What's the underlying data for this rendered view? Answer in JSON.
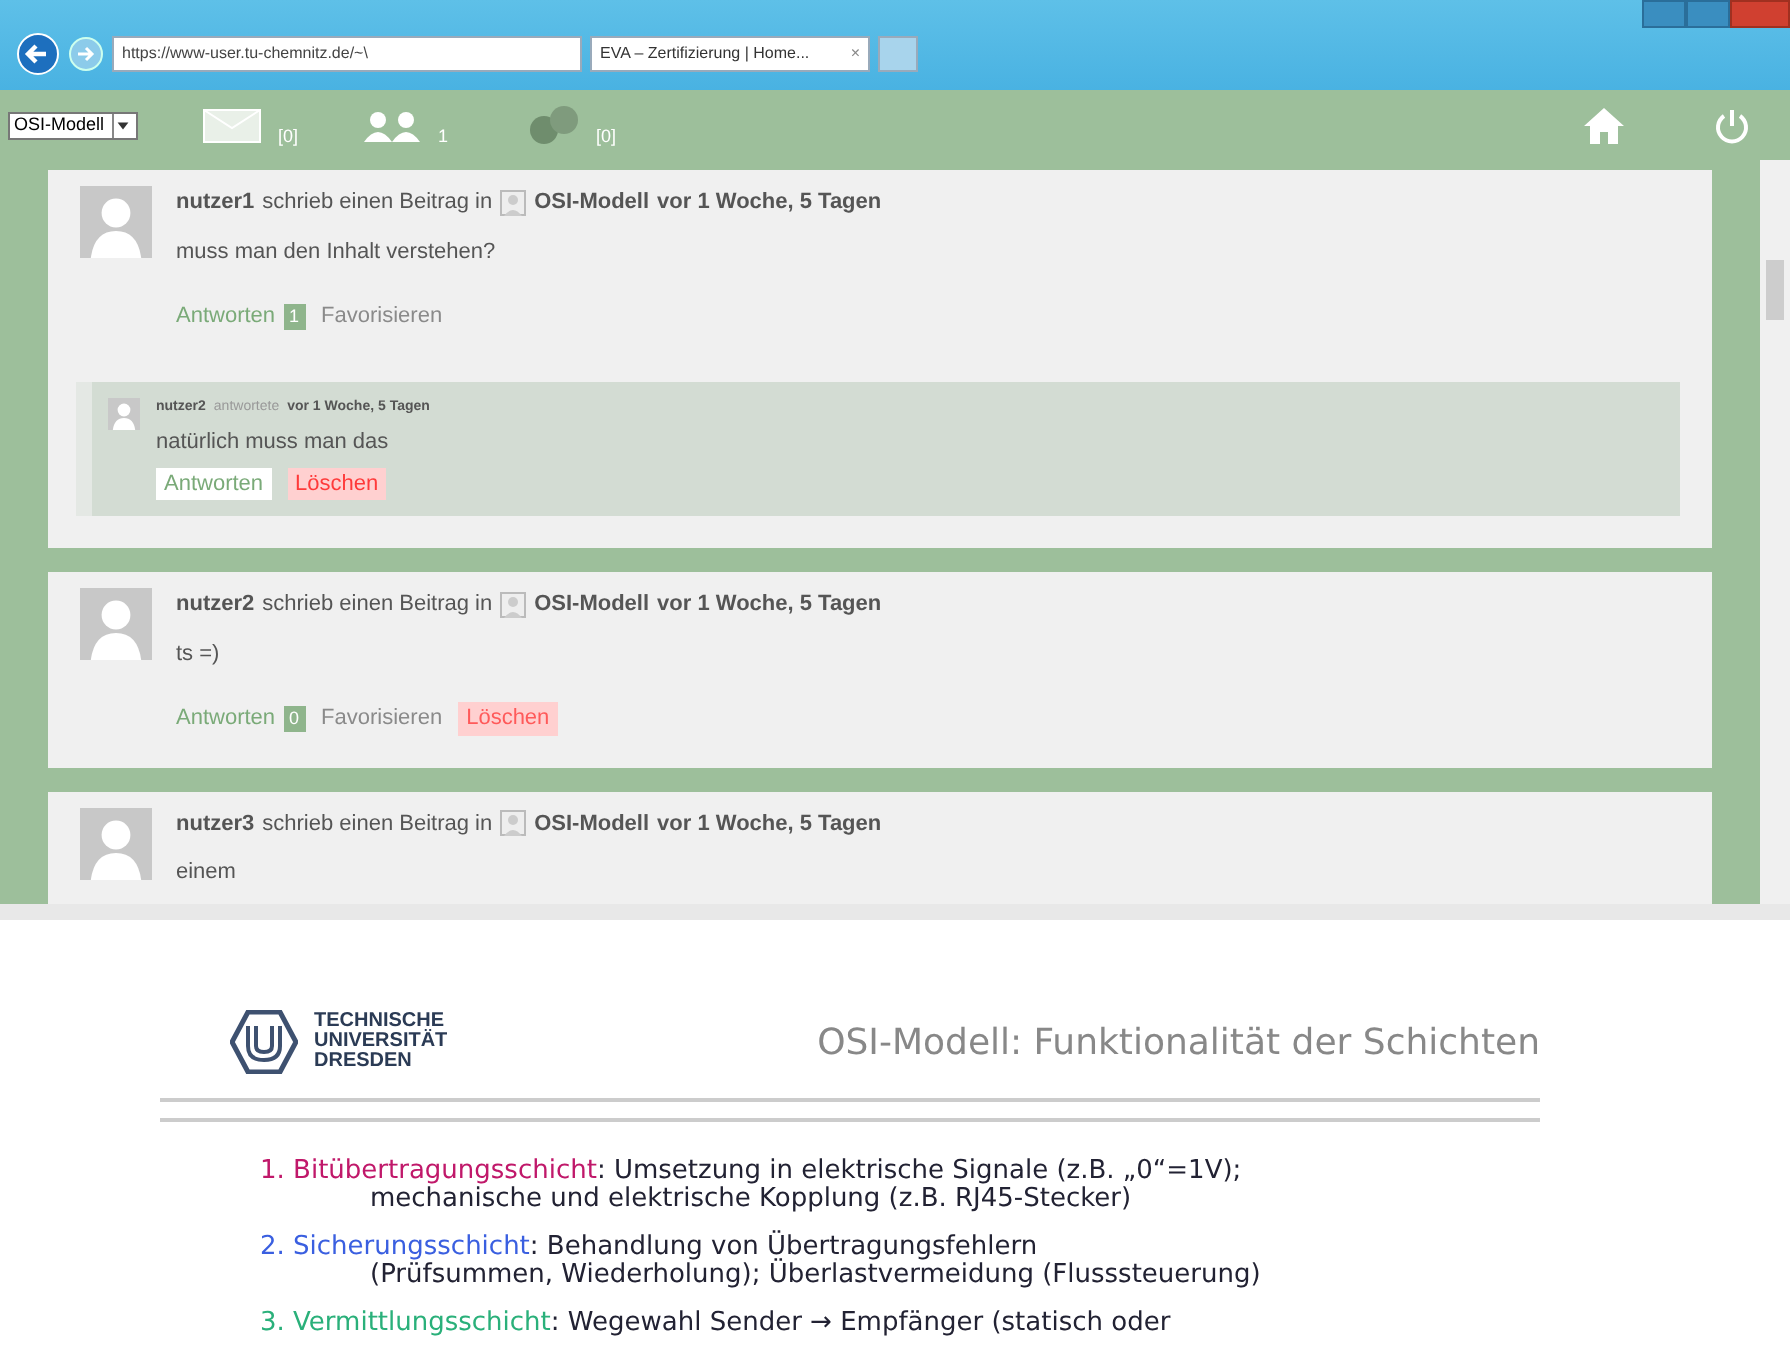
{
  "browser": {
    "address": "https://www-user.tu-chemnitz.de/~\\",
    "tab": {
      "title": "EVA – Zertifizierung | Home...",
      "close": "×"
    }
  },
  "toolbar": {
    "course_select": "OSI-Modell",
    "messages_count": "[0]",
    "contacts_count": "1",
    "questions_count": "[0]"
  },
  "posts": [
    {
      "author": "nutzer1",
      "action": "schrieb einen Beitrag in",
      "topic": "OSI-Modell",
      "time": "vor 1 Woche, 5 Tagen",
      "content": "muss man den Inhalt verstehen?",
      "reply_label": "Antworten",
      "reply_count": "1",
      "favorite_label": "Favorisieren",
      "replies": [
        {
          "author": "nutzer2",
          "action": "antwortete",
          "time": "vor 1 Woche, 5 Tagen",
          "content": "natürlich muss man das",
          "reply_label": "Antworten",
          "delete_label": "Löschen"
        }
      ]
    },
    {
      "author": "nutzer2",
      "action": "schrieb einen Beitrag in",
      "topic": "OSI-Modell",
      "time": "vor 1 Woche, 5 Tagen",
      "content": "ts =)",
      "reply_label": "Antworten",
      "reply_count": "0",
      "favorite_label": "Favorisieren",
      "delete_label": "Löschen"
    },
    {
      "author": "nutzer3",
      "action": "schrieb einen Beitrag in",
      "topic": "OSI-Modell",
      "time": "vor 1 Woche, 5 Tagen",
      "content": "einem"
    }
  ],
  "slide": {
    "logo_lines": [
      "TECHNISCHE",
      "UNIVERSITÄT",
      "DRESDEN"
    ],
    "title": "OSI-Modell: Funktionalität der Schichten",
    "items": [
      {
        "number": "1.",
        "term": "Bitübertragungsschicht",
        "color": "#c0186a",
        "lines": [
          ": Umsetzung in elektrische Signale (z.B. „0“=1V);",
          "mechanische und elektrische Kopplung (z.B. RJ45-Stecker)"
        ]
      },
      {
        "number": "2.",
        "term": "Sicherungsschicht",
        "color": "#3a5fe0",
        "lines": [
          ": Behandlung von Übertragungsfehlern",
          "(Prüfsummen, Wiederholung); Überlastvermeidung (Flusssteuerung)"
        ]
      },
      {
        "number": "3.",
        "term": "Vermittlungsschicht",
        "color": "#2ab07a",
        "lines": [
          ": Wegewahl Sender → Empfänger (statisch oder"
        ]
      }
    ]
  }
}
